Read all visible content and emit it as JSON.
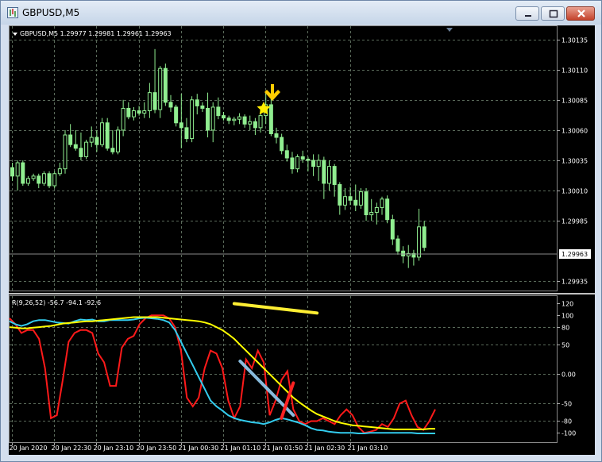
{
  "window": {
    "title": "GBPUSD,M5",
    "buttons": [
      "minimize",
      "maximize",
      "close"
    ]
  },
  "chart_header": {
    "symbol_line": "GBPUSD,M5  1.29977 1.29981 1.29961 1.29963"
  },
  "indicator_header": "R(9,26,52) -56.7 -94.1 -92.6",
  "current_price_label": "1.29963",
  "colors": {
    "background": "#000000",
    "bull_candle": "#90ee90",
    "bear_candle": "#90ee90",
    "grid": "#5a6a5a",
    "line_fast": "#ff1a1a",
    "line_mid": "#33ccee",
    "line_slow": "#ffff00",
    "annotation_star": "#ffff00",
    "annotation_arrow": "#ffcc00"
  },
  "icons": [
    "chart-window-icon",
    "dropdown-triangle-icon",
    "star-icon",
    "down-arrow-icon"
  ],
  "chart_data": [
    {
      "type": "candlestick",
      "title": "GBPUSD,M5",
      "y_ticks": [
        "1.30135",
        "1.30110",
        "1.30085",
        "1.30060",
        "1.30035",
        "1.30010",
        "1.29985",
        "1.29963",
        "1.29935"
      ],
      "ylim": [
        1.2993,
        1.3015
      ],
      "grid": true,
      "x_ticks": [
        "20 Jan 2020",
        "20 Jan 22:30",
        "20 Jan 23:10",
        "20 Jan 23:50",
        "21 Jan 00:30",
        "21 Jan 01:10",
        "21 Jan 01:50",
        "21 Jan 02:30",
        "21 Jan 03:10"
      ],
      "candles": [
        [
          1.30029,
          1.30033,
          1.30018,
          1.30022
        ],
        [
          1.30022,
          1.30035,
          1.3001,
          1.30033
        ],
        [
          1.30033,
          1.30035,
          1.30014,
          1.30016
        ],
        [
          1.30016,
          1.30022,
          1.30014,
          1.3002
        ],
        [
          1.3002,
          1.30024,
          1.30018,
          1.30022
        ],
        [
          1.30022,
          1.30024,
          1.30012,
          1.30016
        ],
        [
          1.30016,
          1.30026,
          1.30014,
          1.30024
        ],
        [
          1.30024,
          1.30026,
          1.30012,
          1.30014
        ],
        [
          1.30014,
          1.30026,
          1.30012,
          1.30024
        ],
        [
          1.30024,
          1.30033,
          1.30022,
          1.30028
        ],
        [
          1.30028,
          1.3006,
          1.30024,
          1.30056
        ],
        [
          1.30056,
          1.30065,
          1.30046,
          1.30048
        ],
        [
          1.30048,
          1.3006,
          1.30043,
          1.30045
        ],
        [
          1.30045,
          1.30058,
          1.30035,
          1.30038
        ],
        [
          1.30038,
          1.30052,
          1.30036,
          1.3005
        ],
        [
          1.3005,
          1.30063,
          1.30046,
          1.30054
        ],
        [
          1.30054,
          1.3006,
          1.30042,
          1.30048
        ],
        [
          1.30048,
          1.3007,
          1.30046,
          1.30066
        ],
        [
          1.30066,
          1.3007,
          1.30043,
          1.30045
        ],
        [
          1.30045,
          1.3006,
          1.3004,
          1.30042
        ],
        [
          1.30042,
          1.30063,
          1.3004,
          1.3006
        ],
        [
          1.3006,
          1.30085,
          1.30055,
          1.30078
        ],
        [
          1.30078,
          1.30083,
          1.30069,
          1.30071
        ],
        [
          1.30071,
          1.30079,
          1.30068,
          1.30076
        ],
        [
          1.30076,
          1.3008,
          1.30072,
          1.30074
        ],
        [
          1.30074,
          1.30083,
          1.3007,
          1.30076
        ],
        [
          1.30076,
          1.30099,
          1.3007,
          1.30091
        ],
        [
          1.30091,
          1.30127,
          1.30074,
          1.30077
        ],
        [
          1.30077,
          1.30113,
          1.3007,
          1.30111
        ],
        [
          1.30111,
          1.30115,
          1.3008,
          1.30083
        ],
        [
          1.30083,
          1.30089,
          1.30075,
          1.30079
        ],
        [
          1.30079,
          1.30081,
          1.30063,
          1.30066
        ],
        [
          1.30066,
          1.3009,
          1.30045,
          1.30062
        ],
        [
          1.30062,
          1.3007,
          1.3005,
          1.30053
        ],
        [
          1.30053,
          1.30088,
          1.3005,
          1.30085
        ],
        [
          1.30085,
          1.3009,
          1.30073,
          1.3008
        ],
        [
          1.3008,
          1.30083,
          1.30075,
          1.30078
        ],
        [
          1.30078,
          1.30091,
          1.30054,
          1.3006
        ],
        [
          1.3006,
          1.30083,
          1.3005,
          1.30079
        ],
        [
          1.30079,
          1.30087,
          1.30069,
          1.30072
        ],
        [
          1.30072,
          1.30075,
          1.30068,
          1.3007
        ],
        [
          1.3007,
          1.30072,
          1.30065,
          1.30068
        ],
        [
          1.30068,
          1.30071,
          1.30064,
          1.30069
        ],
        [
          1.30069,
          1.30074,
          1.30065,
          1.30071
        ],
        [
          1.30071,
          1.30073,
          1.30062,
          1.30065
        ],
        [
          1.30065,
          1.30072,
          1.3006,
          1.30067
        ],
        [
          1.30067,
          1.3007,
          1.30056,
          1.30062
        ],
        [
          1.30062,
          1.30077,
          1.30058,
          1.30072
        ],
        [
          1.30072,
          1.30091,
          1.30065,
          1.30081
        ],
        [
          1.30081,
          1.30088,
          1.30055,
          1.30057
        ],
        [
          1.30057,
          1.30062,
          1.30049,
          1.30054
        ],
        [
          1.30054,
          1.30057,
          1.3004,
          1.30043
        ],
        [
          1.30043,
          1.30048,
          1.30034,
          1.30037
        ],
        [
          1.30037,
          1.30042,
          1.30024,
          1.30028
        ],
        [
          1.30028,
          1.3004,
          1.30025,
          1.30038
        ],
        [
          1.30038,
          1.30043,
          1.30033,
          1.30036
        ],
        [
          1.30036,
          1.30038,
          1.30026,
          1.30035
        ],
        [
          1.30035,
          1.3004,
          1.30022,
          1.3003
        ],
        [
          1.3003,
          1.3004,
          1.30018,
          1.30035
        ],
        [
          1.30035,
          1.30038,
          1.30003,
          1.30016
        ],
        [
          1.30016,
          1.30035,
          1.3001,
          1.3003
        ],
        [
          1.3003,
          1.30032,
          1.30005,
          1.30015
        ],
        [
          1.30015,
          1.30017,
          1.2999,
          1.29998
        ],
        [
          1.29998,
          1.30012,
          1.29994,
          1.30005
        ],
        [
          1.30005,
          1.30013,
          1.29998,
          1.30002
        ],
        [
          1.30002,
          1.30015,
          1.29993,
          1.29998
        ],
        [
          1.29998,
          1.30012,
          1.29995,
          1.30009
        ],
        [
          1.30009,
          1.30012,
          1.29985,
          1.2999
        ],
        [
          1.2999,
          1.30003,
          1.29985,
          1.29992
        ],
        [
          1.29992,
          1.3,
          1.29982,
          1.29996
        ],
        [
          1.29996,
          1.30005,
          1.2999,
          1.30003
        ],
        [
          1.30003,
          1.30006,
          1.29983,
          1.29986
        ],
        [
          1.29986,
          1.2999,
          1.29965,
          1.2997
        ],
        [
          1.2997,
          1.29973,
          1.29957,
          1.2996
        ],
        [
          1.2996,
          1.29964,
          1.2995,
          1.29956
        ],
        [
          1.29956,
          1.29965,
          1.29946,
          1.29958
        ],
        [
          1.29958,
          1.29961,
          1.29948,
          1.29955
        ],
        [
          1.29955,
          1.29995,
          1.29952,
          1.2998
        ],
        [
          1.2998,
          1.29985,
          1.2996,
          1.29963
        ]
      ]
    },
    {
      "type": "line",
      "title": "R(9,26,52)",
      "y_ticks": [
        "120",
        "100",
        "80",
        "50",
        "0.00",
        "-50",
        "-80",
        "-100"
      ],
      "ylim": [
        -105,
        125
      ],
      "series": [
        {
          "name": "-56.7",
          "color": "#ff1a1a",
          "values": [
            95,
            85,
            70,
            75,
            75,
            60,
            10,
            -75,
            -70,
            -10,
            55,
            70,
            75,
            75,
            70,
            35,
            20,
            -20,
            -20,
            45,
            60,
            65,
            85,
            95,
            100,
            100,
            100,
            95,
            80,
            40,
            -40,
            -55,
            -40,
            10,
            40,
            35,
            10,
            -45,
            -75,
            -55,
            25,
            10,
            40,
            20,
            -70,
            -45,
            -10,
            5,
            -60,
            -80,
            -85,
            -80,
            -80,
            -75,
            -80,
            -85,
            -70,
            -60,
            -70,
            -90,
            -100,
            -98,
            -95,
            -85,
            -90,
            -75,
            -50,
            -45,
            -70,
            -90,
            -95,
            -80,
            -60
          ]
        },
        {
          "name": "-94.1",
          "color": "#33ccee",
          "values": [
            90,
            85,
            82,
            85,
            90,
            92,
            92,
            90,
            88,
            87,
            86,
            90,
            93,
            92,
            93,
            90,
            90,
            92,
            92,
            92,
            92,
            93,
            95,
            96,
            95,
            94,
            92,
            88,
            75,
            55,
            35,
            15,
            -5,
            -25,
            -45,
            -55,
            -62,
            -70,
            -75,
            -78,
            -80,
            -82,
            -83,
            -85,
            -82,
            -78,
            -75,
            -77,
            -80,
            -83,
            -87,
            -92,
            -95,
            -96,
            -98,
            -99,
            -100,
            -100,
            -100,
            -101,
            -101,
            -100,
            -100,
            -100,
            -100,
            -100,
            -100,
            -100,
            -100,
            -101,
            -101,
            -101,
            -101
          ]
        },
        {
          "name": "-92.6",
          "color": "#ffff00",
          "values": [
            80,
            79,
            78,
            78,
            79,
            80,
            81,
            82,
            84,
            86,
            87,
            88,
            89,
            90,
            90,
            91,
            92,
            93,
            94,
            95,
            96,
            97,
            97,
            97,
            97,
            97,
            96,
            95,
            94,
            93,
            92,
            91,
            90,
            88,
            85,
            80,
            75,
            68,
            60,
            50,
            40,
            30,
            20,
            10,
            0,
            -10,
            -20,
            -30,
            -40,
            -48,
            -55,
            -62,
            -68,
            -72,
            -76,
            -80,
            -83,
            -85,
            -87,
            -88,
            -89,
            -90,
            -91,
            -92,
            -93,
            -94,
            -94,
            -94,
            -94,
            -94,
            -94,
            -93,
            -93
          ]
        }
      ],
      "annotations": [
        {
          "color": "#ffee33",
          "from": [
            38,
            120
          ],
          "to": [
            52,
            104
          ]
        },
        {
          "color": "#88bbdd",
          "from": [
            39,
            22
          ],
          "to": [
            48,
            -70
          ]
        },
        {
          "color": "#ff2222",
          "from": [
            46,
            -75
          ],
          "to": [
            48,
            -15
          ]
        }
      ]
    }
  ]
}
